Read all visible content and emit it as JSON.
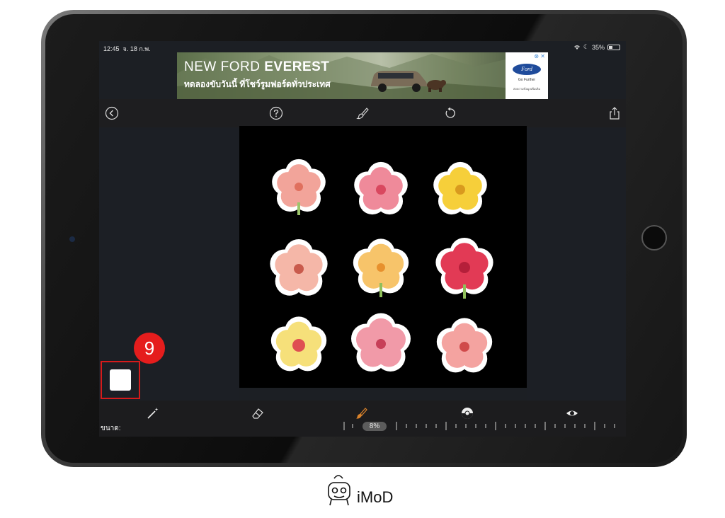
{
  "status_bar": {
    "time": "12:45",
    "date": "จ. 18 ก.พ.",
    "battery": "35%"
  },
  "ad": {
    "line1_regular": "NEW FORD ",
    "line1_bold": "EVEREST",
    "line2": "ทดลองขับวันนี้ ที่โชว์รูมฟอร์ดทั่วประเทศ",
    "brand": "Ford",
    "tagline": "Go Further",
    "small_print": "สอบถามข้อมูลเพิ่มเติม",
    "close": "⊗ ✕"
  },
  "toolbar_top": {
    "back_icon": "chevron-left-circle-icon",
    "help_icon": "question-circle-icon",
    "brush_icon": "brush-icon",
    "rotate_icon": "rotate-icon",
    "share_icon": "share-icon"
  },
  "callout": {
    "number": "9",
    "color": "#e51d1d"
  },
  "bottom_bar": {
    "size_label": "ขนาด:",
    "size_value": "8%",
    "tools": [
      "magic-wand-icon",
      "eraser-icon",
      "brush-icon",
      "mask-toggle-icon",
      "eye-icon"
    ],
    "active_tool_color": "#d9822b"
  },
  "watermark": {
    "text": "iMoD"
  }
}
